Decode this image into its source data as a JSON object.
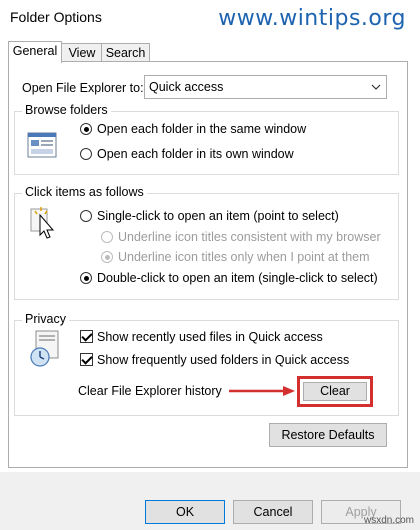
{
  "window": {
    "title": "Folder Options",
    "watermark": "www.wintips.org"
  },
  "tabs": [
    {
      "label": "General"
    },
    {
      "label": "View"
    },
    {
      "label": "Search"
    }
  ],
  "open_explorer": {
    "label": "Open File Explorer to:",
    "value": "Quick access"
  },
  "browse_folders": {
    "title": "Browse folders",
    "options": [
      {
        "label": "Open each folder in the same window",
        "checked": true
      },
      {
        "label": "Open each folder in its own window",
        "checked": false
      }
    ]
  },
  "click_items": {
    "title": "Click items as follows",
    "options": [
      {
        "label": "Single-click to open an item (point to select)",
        "checked": false,
        "disabled": false
      },
      {
        "label": "Underline icon titles consistent with my browser",
        "checked": false,
        "disabled": true
      },
      {
        "label": "Underline icon titles only when I point at them",
        "checked": true,
        "disabled": true
      },
      {
        "label": "Double-click to open an item (single-click to select)",
        "checked": true,
        "disabled": false
      }
    ]
  },
  "privacy": {
    "title": "Privacy",
    "checks": [
      {
        "label": "Show recently used files in Quick access",
        "checked": true
      },
      {
        "label": "Show frequently used folders in Quick access",
        "checked": true
      }
    ],
    "clear_label": "Clear File Explorer history",
    "clear_button": "Clear"
  },
  "restore_button": "Restore Defaults",
  "footer": {
    "ok": "OK",
    "cancel": "Cancel",
    "apply": "Apply",
    "watermark": "wsxdn.com"
  },
  "colors": {
    "accent": "#d32f2f",
    "watermark": "#1d63b0"
  }
}
